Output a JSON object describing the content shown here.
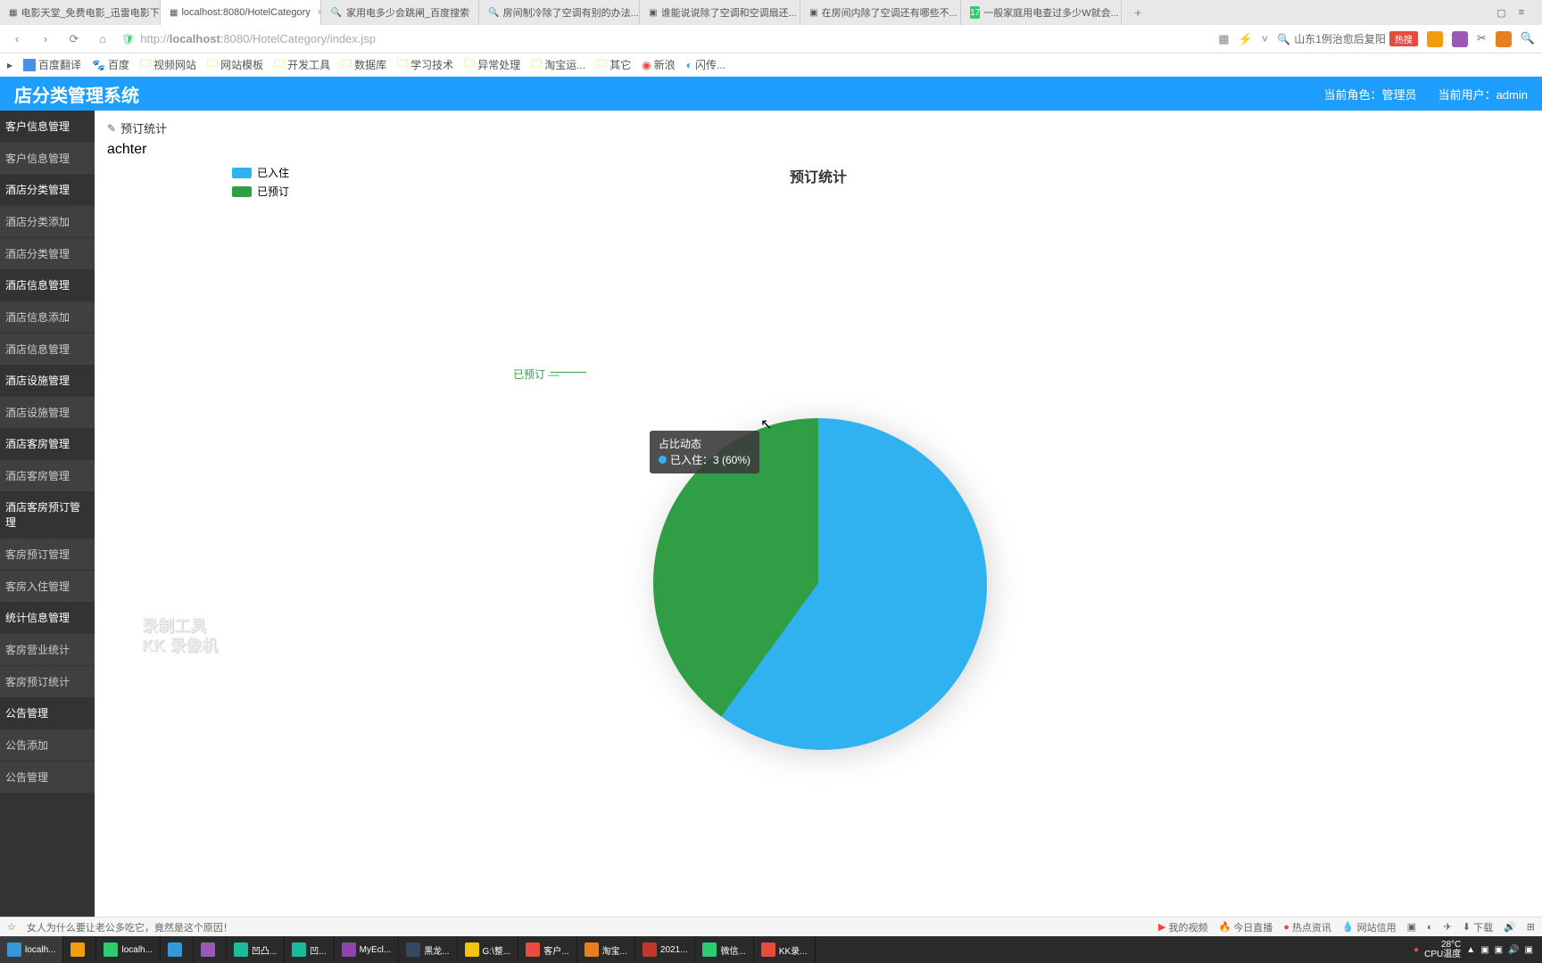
{
  "tabs": [
    {
      "label": "电影天堂_免费电影_迅雷电影下"
    },
    {
      "label": "localhost:8080/HotelCategory",
      "active": true
    },
    {
      "label": "家用电多少会跳闸_百度搜索"
    },
    {
      "label": "房间制冷除了空调有别的办法..."
    },
    {
      "label": "谁能说说除了空调和空调扇还..."
    },
    {
      "label": "在房间内除了空调还有哪些不..."
    },
    {
      "label": "一般家庭用电查过多少W就会..."
    }
  ],
  "url": {
    "host": "localhost",
    "path": ":8080/HotelCategory/index.jsp",
    "prefix": "http://"
  },
  "search_hint": "山东1例治愈后复阳",
  "hot_label": "热搜",
  "bookmarks": [
    "百度翻译",
    "百度",
    "视频网站",
    "网站模板",
    "开发工具",
    "数据库",
    "学习技术",
    "异常处理",
    "淘宝运...",
    "其它",
    "新浪",
    "闪传..."
  ],
  "header": {
    "title": "店分类管理系统",
    "role_label": "当前角色：",
    "role_value": "管理员",
    "user_label": "当前用户：",
    "user_value": "admin"
  },
  "sidebar": [
    {
      "type": "group",
      "label": "客户信息管理"
    },
    {
      "type": "item",
      "label": "客户信息管理"
    },
    {
      "type": "group",
      "label": "酒店分类管理"
    },
    {
      "type": "item",
      "label": "酒店分类添加"
    },
    {
      "type": "item",
      "label": "酒店分类管理"
    },
    {
      "type": "group",
      "label": "酒店信息管理"
    },
    {
      "type": "item",
      "label": "酒店信息添加"
    },
    {
      "type": "item",
      "label": "酒店信息管理"
    },
    {
      "type": "group",
      "label": "酒店设施管理"
    },
    {
      "type": "item",
      "label": "酒店设施管理"
    },
    {
      "type": "group",
      "label": "酒店客房管理"
    },
    {
      "type": "item",
      "label": "酒店客房管理"
    },
    {
      "type": "group",
      "label": "酒店客房预订管理"
    },
    {
      "type": "item",
      "label": "客房预订管理"
    },
    {
      "type": "item",
      "label": "客房入住管理"
    },
    {
      "type": "group",
      "label": "统计信息管理"
    },
    {
      "type": "item",
      "label": "客房营业统计"
    },
    {
      "type": "item",
      "label": "客房预订统计"
    },
    {
      "type": "group",
      "label": "公告管理"
    },
    {
      "type": "item",
      "label": "公告添加"
    },
    {
      "type": "item",
      "label": "公告管理"
    }
  ],
  "panel_title": "预订统计",
  "chart_data": {
    "type": "pie",
    "title": "预订统计",
    "series": [
      {
        "name": "已入住",
        "value": 3,
        "percent": 60,
        "color": "#30b1f0"
      },
      {
        "name": "已预订",
        "value": 2,
        "percent": 40,
        "color": "#2f9e44"
      }
    ],
    "tooltip": {
      "title": "占比动态",
      "line": "已入住：3 (60%)"
    }
  },
  "watermark": {
    "l1": "录制工具",
    "l2": "KK 录像机"
  },
  "news": {
    "headline": "女人为什么要让老公多吃它，竟然是这个原因！",
    "right": [
      "我的视频",
      "今日直播",
      "热点资讯",
      "网站信用",
      "下载"
    ]
  },
  "taskbar": {
    "items": [
      "localh...",
      "",
      "localh...",
      "",
      "",
      "凹凸...",
      "凹...",
      "MyEcl...",
      "黑龙...",
      "G:\\整...",
      "客户...",
      "淘宝...",
      "2021...",
      "微信...",
      "KK录..."
    ],
    "temp": "28°C",
    "cpu": "CPU温度"
  }
}
